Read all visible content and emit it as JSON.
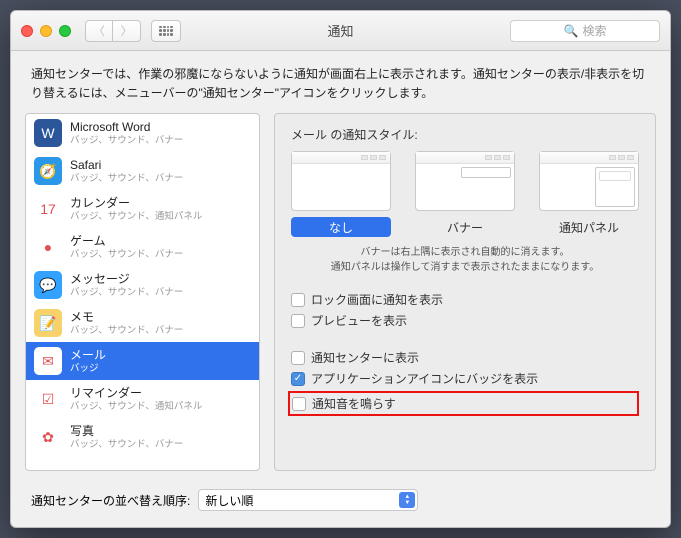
{
  "window": {
    "title": "通知",
    "searchPlaceholder": "検索"
  },
  "description": "通知センターでは、作業の邪魔にならないように通知が画面右上に表示されます。通知センターの表示/非表示を切り替えるには、メニューバーの\"通知センター\"アイコンをクリックします。",
  "apps": [
    {
      "id": "word",
      "name": "Microsoft Word",
      "sub": "バッジ、サウンド、バナー",
      "iconBg": "#2b579a",
      "glyph": "W"
    },
    {
      "id": "safari",
      "name": "Safari",
      "sub": "バッジ、サウンド、バナー",
      "iconBg": "#2a97e8",
      "glyph": "🧭"
    },
    {
      "id": "calendar",
      "name": "カレンダー",
      "sub": "バッジ、サウンド、通知パネル",
      "iconBg": "#ffffff",
      "glyph": "17"
    },
    {
      "id": "gamecenter",
      "name": "ゲーム",
      "sub": "バッジ、サウンド、バナー",
      "iconBg": "#ffffff",
      "glyph": "●"
    },
    {
      "id": "messages",
      "name": "メッセージ",
      "sub": "バッジ、サウンド、バナー",
      "iconBg": "#33a1ff",
      "glyph": "💬"
    },
    {
      "id": "notes",
      "name": "メモ",
      "sub": "バッジ、サウンド、バナー",
      "iconBg": "#f7d26a",
      "glyph": "📝"
    },
    {
      "id": "mail",
      "name": "メール",
      "sub": "バッジ",
      "iconBg": "#ffffff",
      "glyph": "✉",
      "selected": true
    },
    {
      "id": "reminders",
      "name": "リマインダー",
      "sub": "バッジ、サウンド、通知パネル",
      "iconBg": "#ffffff",
      "glyph": "☑"
    },
    {
      "id": "photos",
      "name": "写真",
      "sub": "バッジ、サウンド、バナー",
      "iconBg": "#ffffff",
      "glyph": "✿"
    }
  ],
  "detail": {
    "styleTitle": "メール の通知スタイル:",
    "styles": {
      "none": "なし",
      "banner": "バナー",
      "panel": "通知パネル"
    },
    "hint1": "バナーは右上隅に表示され自動的に消えます。",
    "hint2": "通知パネルは操作して消すまで表示されたままになります。",
    "checks": {
      "lock": {
        "label": "ロック画面に通知を表示",
        "checked": false
      },
      "preview": {
        "label": "プレビューを表示",
        "checked": false
      },
      "center": {
        "label": "通知センターに表示",
        "checked": false
      },
      "badge": {
        "label": "アプリケーションアイコンにバッジを表示",
        "checked": true
      },
      "sound": {
        "label": "通知音を鳴らす",
        "checked": false,
        "highlight": true
      }
    }
  },
  "footer": {
    "label": "通知センターの並べ替え順序:",
    "value": "新しい順"
  }
}
